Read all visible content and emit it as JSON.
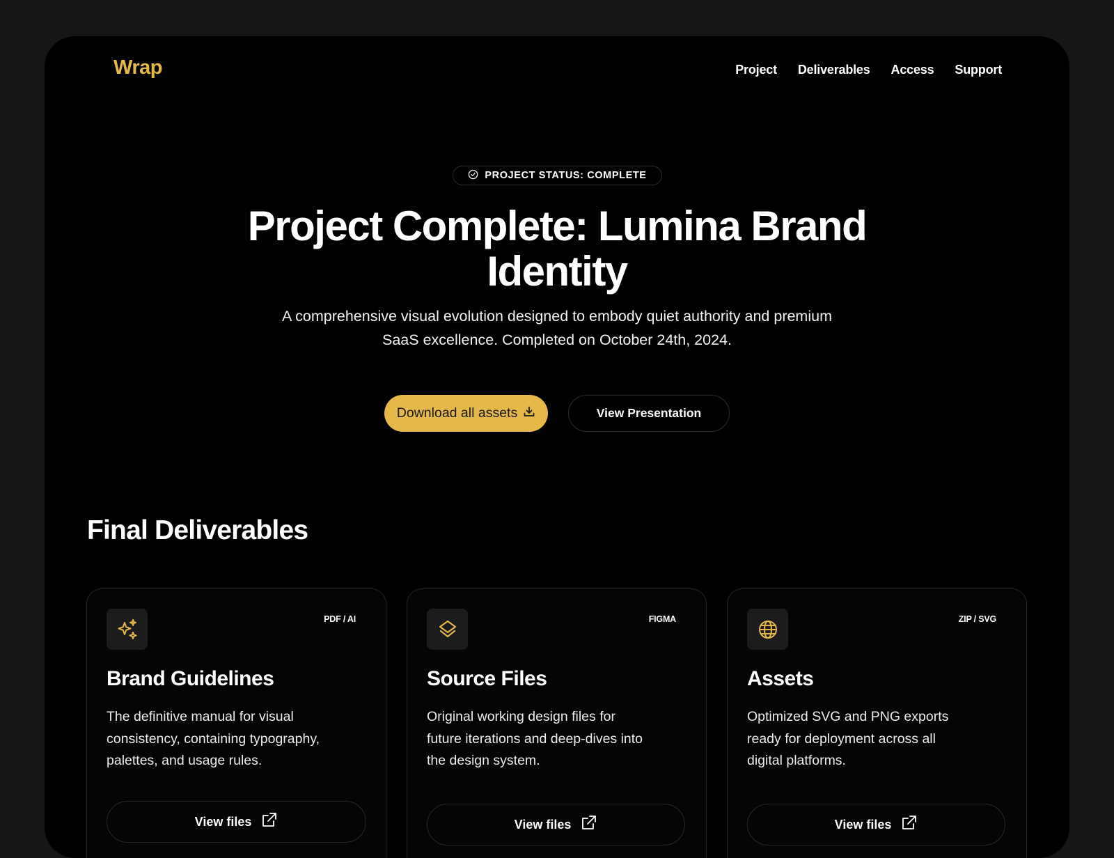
{
  "colors": {
    "accent": "#e5b84a",
    "background": "#000000",
    "outer": "#161616"
  },
  "nav": {
    "logo": "Wrap",
    "links": [
      "Project",
      "Deliverables",
      "Access",
      "Support"
    ]
  },
  "hero": {
    "badge": "PROJECT STATUS: COMPLETE",
    "badge_icon": "check-circle-icon",
    "title": "Project Complete: Lumina Brand Identity",
    "subtitle": "A comprehensive visual evolution designed to embody quiet authority and premium SaaS excellence. Completed on October 24th, 2024.",
    "primary_button": "Download all assets",
    "primary_button_icon": "download-icon",
    "secondary_button": "View Presentation"
  },
  "deliverables": {
    "title": "Final Deliverables",
    "cards": [
      {
        "icon": "sparkles-icon",
        "tag": "PDF / AI",
        "title": "Brand Guidelines",
        "description": "The definitive manual for visual consistency, containing typography, palettes, and usage rules.",
        "button": "View files"
      },
      {
        "icon": "layers-icon",
        "tag": "FIGMA",
        "title": "Source Files",
        "description": "Original working design files for future iterations and deep-dives into the design system.",
        "button": "View files"
      },
      {
        "icon": "globe-icon",
        "tag": "ZIP / SVG",
        "title": "Assets",
        "description": "Optimized SVG and PNG exports ready for deployment across all digital platforms.",
        "button": "View files"
      }
    ]
  }
}
